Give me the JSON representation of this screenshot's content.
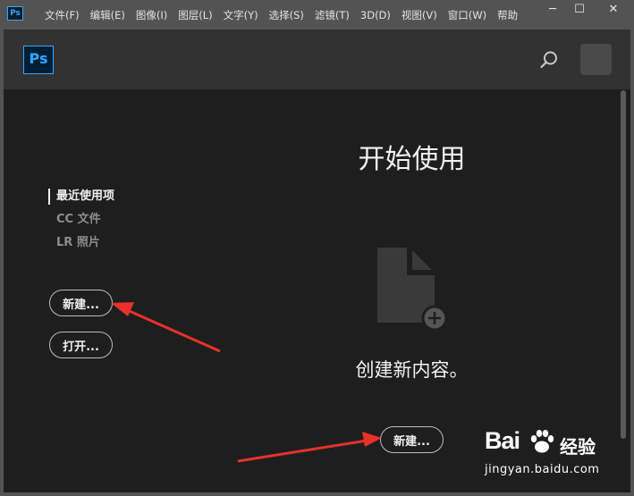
{
  "app": {
    "mini_icon": "Ps",
    "logo": "Ps"
  },
  "menu": [
    "文件(F)",
    "编辑(E)",
    "图像(I)",
    "图层(L)",
    "文字(Y)",
    "选择(S)",
    "滤镜(T)",
    "3D(D)",
    "视图(V)",
    "窗口(W)",
    "帮助"
  ],
  "window_controls": {
    "minimize": "─",
    "maximize": "☐",
    "close": "✕"
  },
  "header": {
    "search_icon": "search-icon",
    "avatar": "avatar"
  },
  "sidebar": {
    "items": [
      {
        "label": "最近使用项",
        "active": true
      },
      {
        "label": "CC 文件",
        "active": false
      },
      {
        "label": "LR 照片",
        "active": false
      }
    ],
    "new_button": "新建...",
    "open_button": "打开..."
  },
  "main": {
    "title": "开始使用",
    "create_text": "创建新内容。",
    "new_button": "新建..."
  },
  "watermark": {
    "brand": "Bai",
    "suffix": "经验",
    "url": "jingyan.baidu.com"
  },
  "colors": {
    "accent": "#31a8ff",
    "arrow": "#e8312a",
    "background": "#1e1e1e",
    "header": "#323232"
  }
}
